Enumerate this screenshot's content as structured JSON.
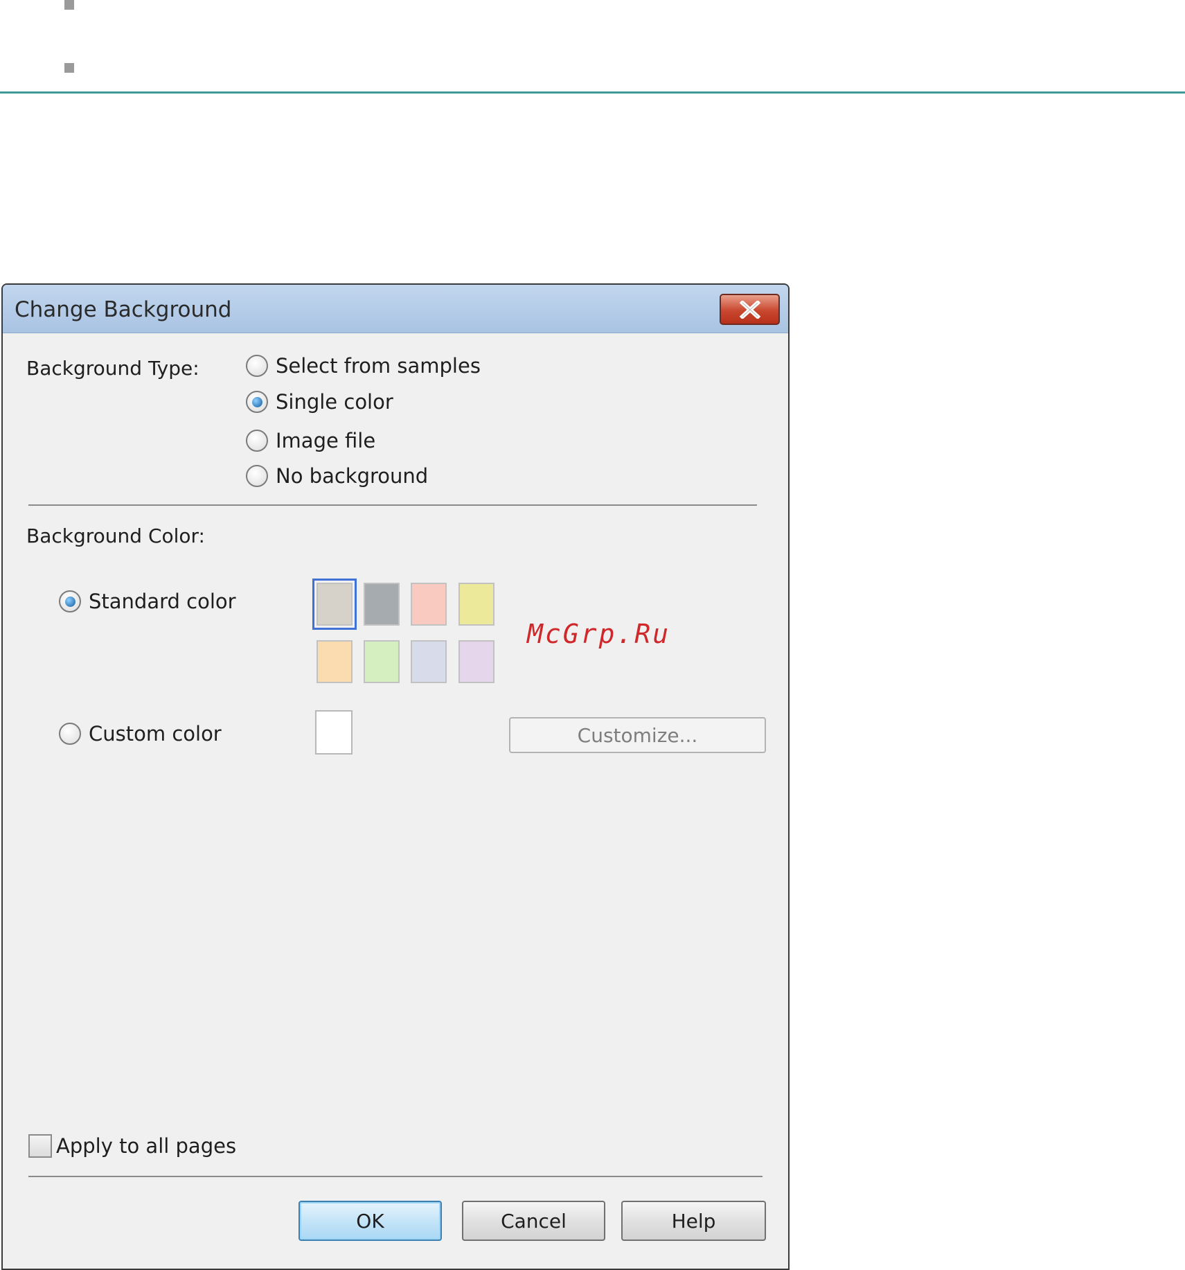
{
  "dialog": {
    "title": "Change Background",
    "close_icon": "close-icon",
    "background_type": {
      "label": "Background Type:",
      "options": [
        {
          "label": "Select from samples",
          "checked": false
        },
        {
          "label": "Single color",
          "checked": true
        },
        {
          "label": "Image file",
          "checked": false
        },
        {
          "label": "No background",
          "checked": false
        }
      ]
    },
    "background_color": {
      "label": "Background Color:",
      "standard_label": "Standard color",
      "standard_checked": true,
      "custom_label": "Custom color",
      "custom_checked": false,
      "swatches": [
        "#d6d1c9",
        "#a5abae",
        "#f9cbc0",
        "#ede99a",
        "#fbdcb0",
        "#d6efc0",
        "#d8dcea",
        "#e5d6ec"
      ],
      "selected_swatch": 0,
      "custom_color": "#ffffff",
      "customize_label": "Customize..."
    },
    "apply_all_label": "Apply to all pages",
    "apply_all_checked": false,
    "buttons": {
      "ok": "OK",
      "cancel": "Cancel",
      "help": "Help"
    }
  },
  "watermark": "McGrp.Ru"
}
